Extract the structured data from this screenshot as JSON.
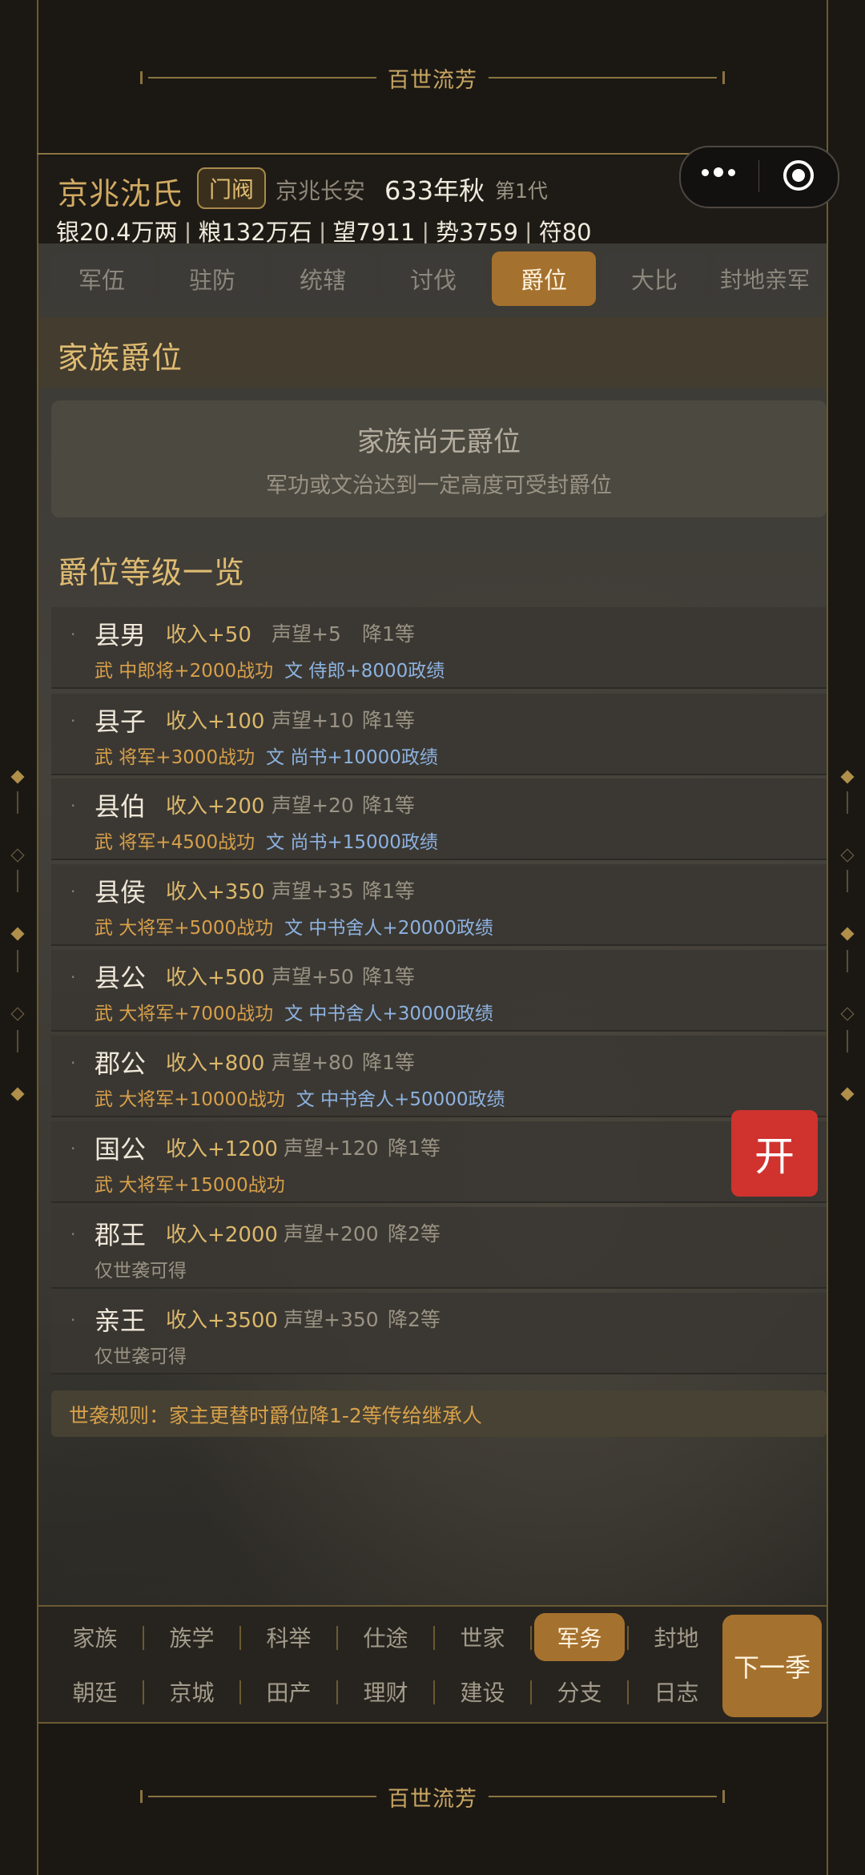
{
  "banner": {
    "title": "百世流芳"
  },
  "header": {
    "clan_name": "京兆沈氏",
    "clan_tag": "门阀",
    "location": "京兆长安",
    "year": "633年秋",
    "generation": "第1代",
    "resources": [
      "银20.4万两",
      "粮132万石",
      "望7911",
      "势3759",
      "符80"
    ],
    "resource_separator": "|"
  },
  "tabs": [
    "军伍",
    "驻防",
    "统辖",
    "讨伐",
    "爵位",
    "大比",
    "封地亲军"
  ],
  "active_tab": "爵位",
  "family_title": {
    "heading": "家族爵位",
    "empty_title": "家族尚无爵位",
    "empty_desc": "军功或文治达到一定高度可受封爵位"
  },
  "rank_list": {
    "heading": "爵位等级一览",
    "bullet": "·",
    "items": [
      {
        "name": "县男",
        "income": "收入+50",
        "prestige": "声望+5",
        "demote": "降1等",
        "mil": "武 中郎将+2000战功",
        "civ": "文 侍郎+8000政绩"
      },
      {
        "name": "县子",
        "income": "收入+100",
        "prestige": "声望+10",
        "demote": "降1等",
        "mil": "武 将军+3000战功",
        "civ": "文 尚书+10000政绩"
      },
      {
        "name": "县伯",
        "income": "收入+200",
        "prestige": "声望+20",
        "demote": "降1等",
        "mil": "武 将军+4500战功",
        "civ": "文 尚书+15000政绩"
      },
      {
        "name": "县侯",
        "income": "收入+350",
        "prestige": "声望+35",
        "demote": "降1等",
        "mil": "武 大将军+5000战功",
        "civ": "文 中书舍人+20000政绩"
      },
      {
        "name": "县公",
        "income": "收入+500",
        "prestige": "声望+50",
        "demote": "降1等",
        "mil": "武 大将军+7000战功",
        "civ": "文 中书舍人+30000政绩"
      },
      {
        "name": "郡公",
        "income": "收入+800",
        "prestige": "声望+80",
        "demote": "降1等",
        "mil": "武 大将军+10000战功",
        "civ": "文 中书舍人+50000政绩"
      },
      {
        "name": "国公",
        "income": "收入+1200",
        "prestige": "声望+120",
        "demote": "降1等",
        "mil": "武 大将军+15000战功",
        "civ": ""
      },
      {
        "name": "郡王",
        "income": "收入+2000",
        "prestige": "声望+200",
        "demote": "降2等",
        "note": "仅世袭可得"
      },
      {
        "name": "亲王",
        "income": "收入+3500",
        "prestige": "声望+350",
        "demote": "降2等",
        "note": "仅世袭可得"
      }
    ]
  },
  "rule": "世袭规则：家主更替时爵位降1-2等传给继承人",
  "float_button": "开",
  "bottom_nav": {
    "row1": [
      "家族",
      "族学",
      "科举",
      "仕途",
      "世家",
      "军务",
      "封地"
    ],
    "row2": [
      "朝廷",
      "京城",
      "田产",
      "理财",
      "建设",
      "分支",
      "日志"
    ],
    "active": "军务",
    "next_button": "下一季"
  },
  "colors": {
    "accent": "#a5712e",
    "gold_text": "#d2aa62",
    "military": "#d8a04a",
    "civil": "#8db2e0",
    "float_button": "#d0322e"
  }
}
